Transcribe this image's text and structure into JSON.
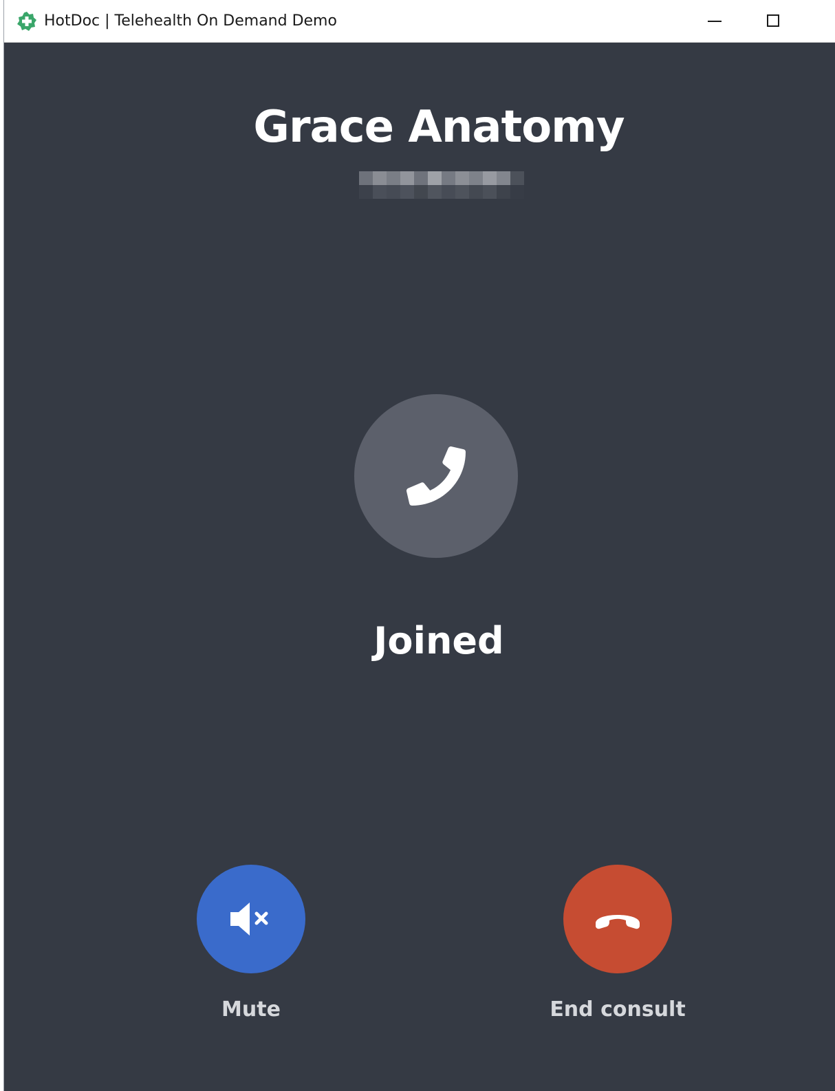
{
  "window": {
    "title": "HotDoc | Telehealth On Demand Demo",
    "minimize_icon": "minimize-icon",
    "maximize_icon": "maximize-icon"
  },
  "call": {
    "caller_name": "Grace Anatomy",
    "status": "Joined",
    "call_icon": "phone-icon"
  },
  "controls": {
    "mute": {
      "label": "Mute",
      "icon": "speaker-muted-icon",
      "color": "#3a6bcb"
    },
    "end": {
      "label": "End consult",
      "icon": "hang-up-icon",
      "color": "#c64c32"
    }
  },
  "colors": {
    "background": "#353a44",
    "call_circle": "#5c606b",
    "brand_icon": "#3aa66a"
  }
}
